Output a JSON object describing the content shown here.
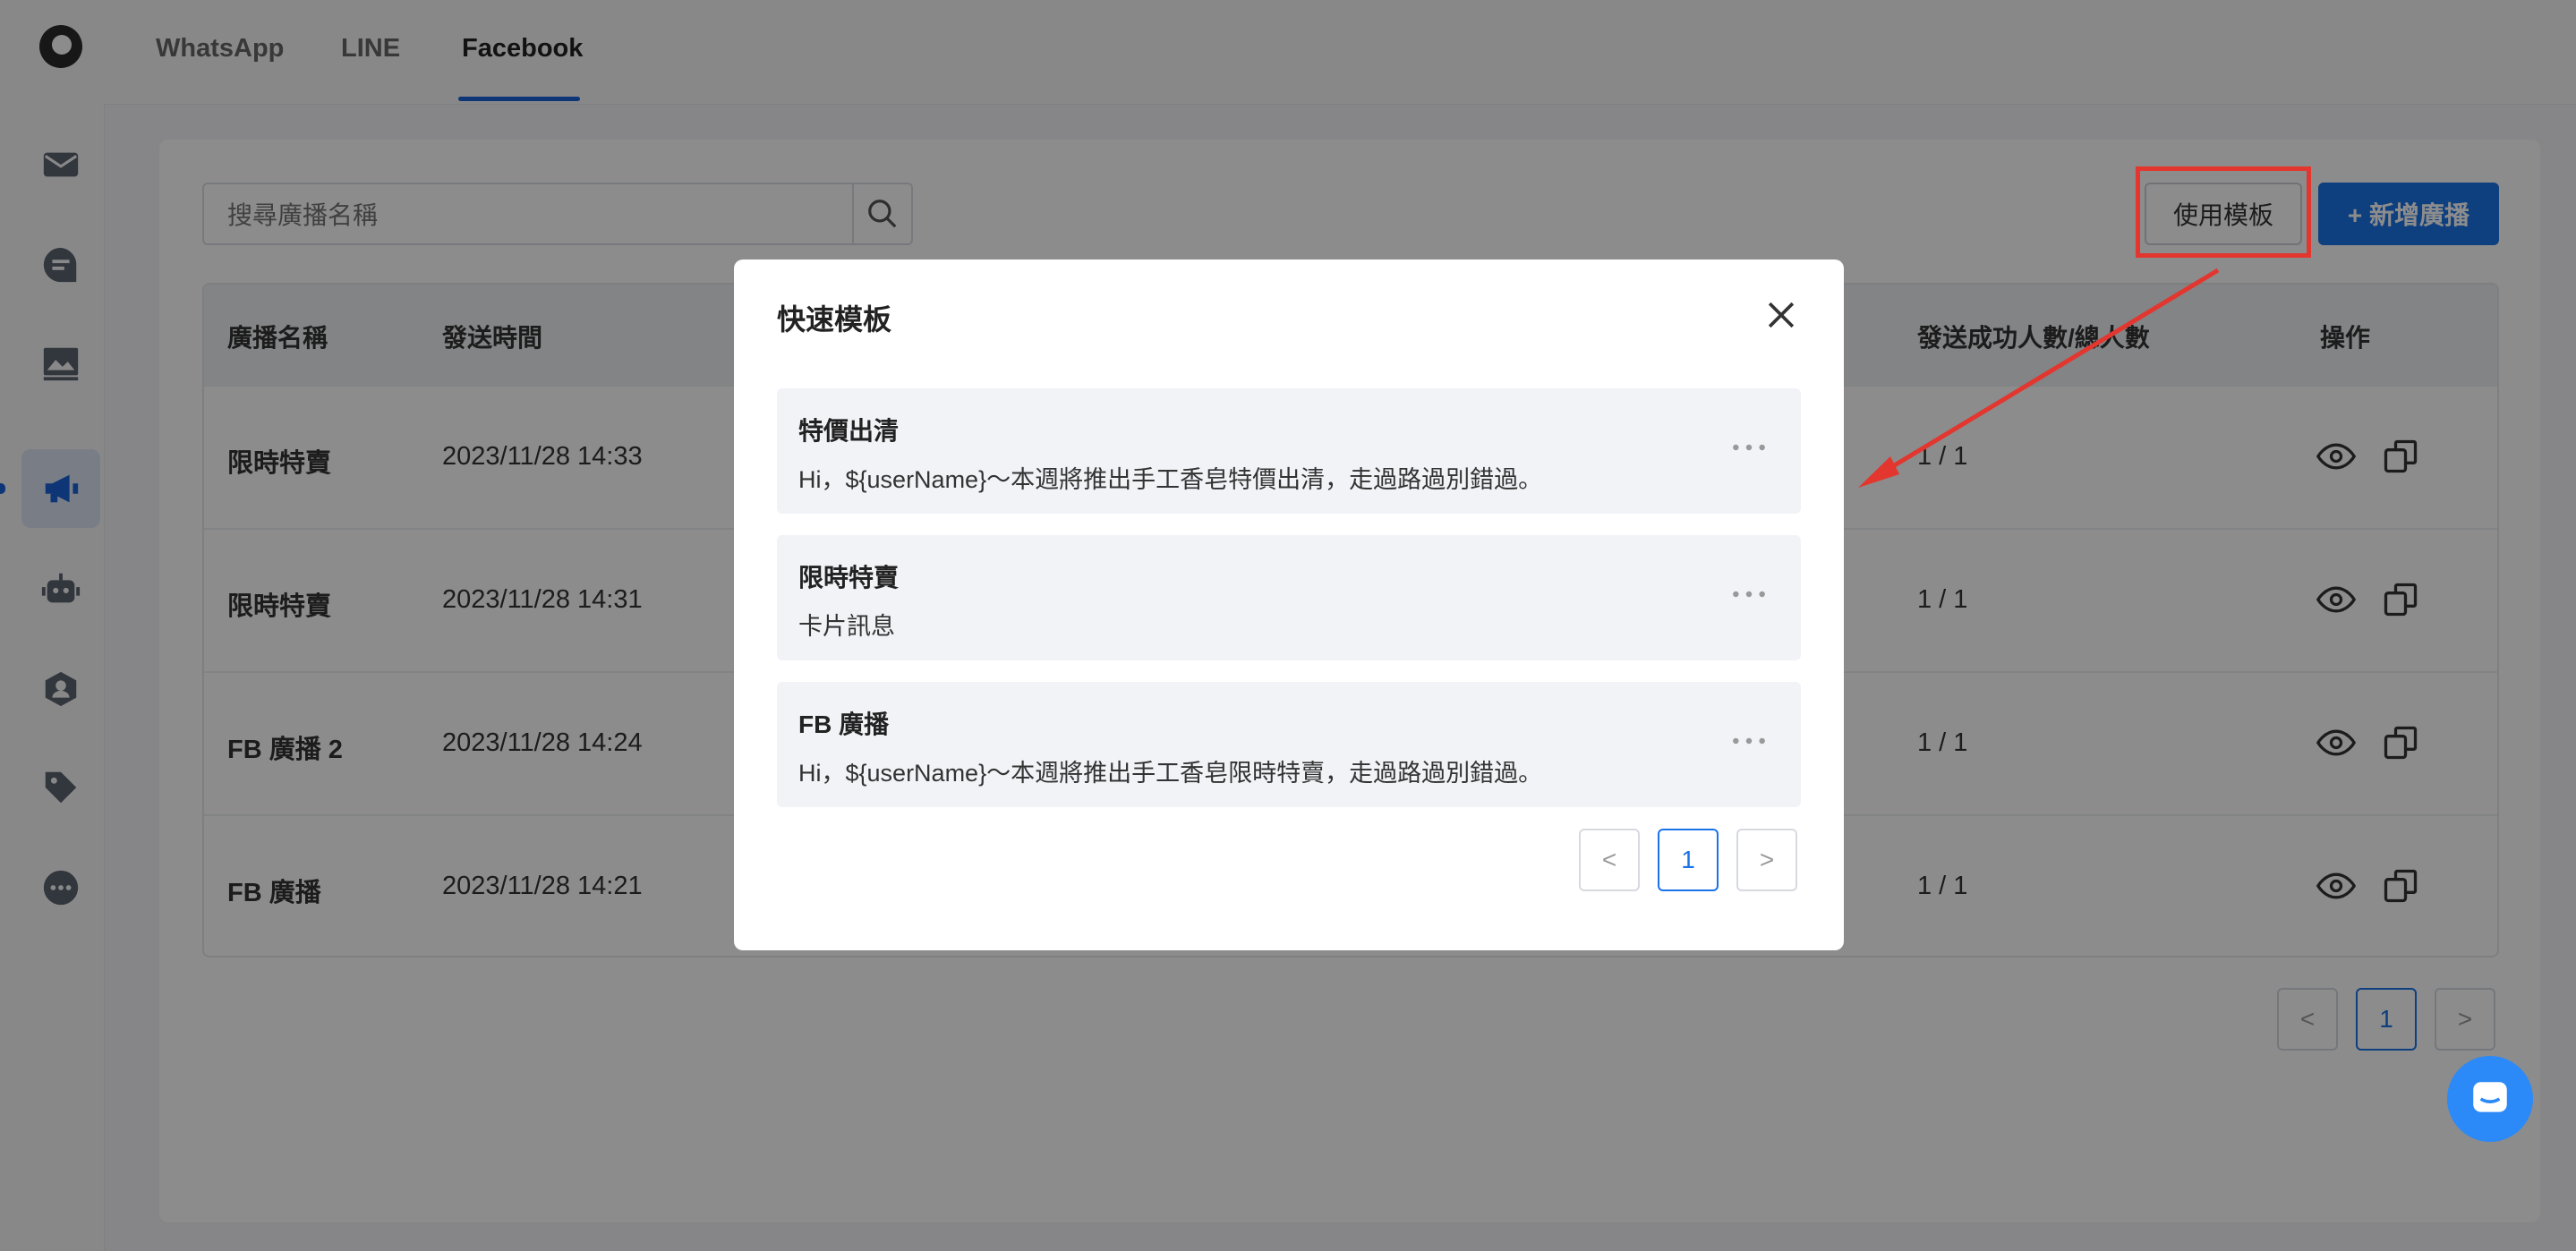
{
  "tabs": [
    "WhatsApp",
    "LINE",
    "Facebook"
  ],
  "search": {
    "placeholder": "搜尋廣播名稱"
  },
  "toolbar": {
    "template_button": "使用模板",
    "new_broadcast_button": "+ 新增廣播"
  },
  "table": {
    "headers": [
      "廣播名稱",
      "發送時間",
      "發送成功人數/總人數",
      "操作"
    ],
    "rows": [
      {
        "name": "限時特賣",
        "time": "2023/11/28 14:33",
        "ratio": "1 / 1"
      },
      {
        "name": "限時特賣",
        "time": "2023/11/28 14:31",
        "ratio": "1 / 1"
      },
      {
        "name": "FB 廣播 2",
        "time": "2023/11/28 14:24",
        "ratio": "1 / 1"
      },
      {
        "name": "FB 廣播",
        "time": "2023/11/28 14:21",
        "ratio": "1 / 1"
      }
    ]
  },
  "pagination": {
    "current": "1",
    "prev": "<",
    "next": ">"
  },
  "modal": {
    "title": "快速模板",
    "templates": [
      {
        "name": "特價出清",
        "body": "Hi，${userName}～本週將推出手工香皂特價出清，走過路過別錯過。"
      },
      {
        "name": "限時特賣",
        "body": "卡片訊息"
      },
      {
        "name": "FB 廣播",
        "body": "Hi，${userName}～本週將推出手工香皂限時特賣，走過路過別錯過。"
      }
    ],
    "pagination": {
      "current": "1",
      "prev": "<",
      "next": ">"
    }
  },
  "colors": {
    "accent": "#1a73e8",
    "highlight": "#e2362f",
    "overlay": "rgba(0,0,0,0.45)"
  },
  "icons": [
    "logo",
    "mail-icon",
    "chat-icon",
    "image-icon",
    "megaphone-icon",
    "bot-icon",
    "contact-icon",
    "tag-icon",
    "more-icon",
    "search-icon",
    "eye-icon",
    "copy-icon",
    "close-icon",
    "ellipsis-icon",
    "chat-support-icon"
  ]
}
